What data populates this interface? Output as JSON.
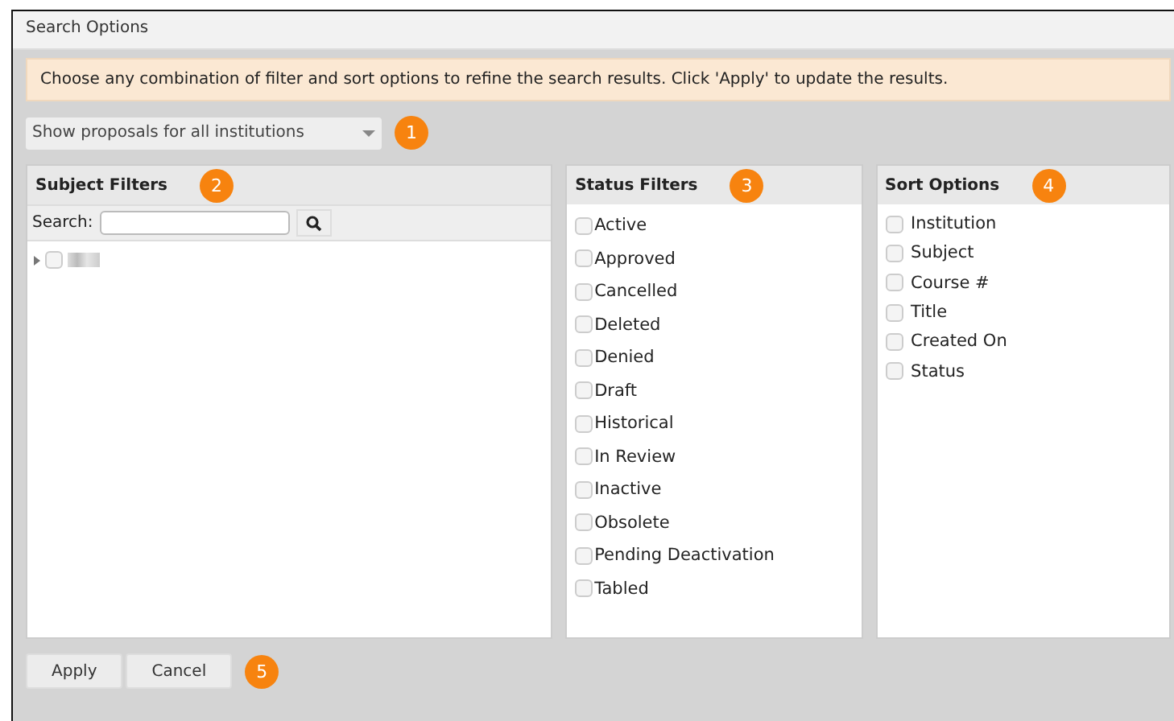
{
  "window": {
    "title": "Search Options"
  },
  "notice": "Choose any combination of filter and sort options to refine the search results. Click 'Apply' to update the results.",
  "scope_dropdown": {
    "value": "Show proposals for all institutions",
    "badge": "1"
  },
  "subject_filters": {
    "title": "Subject Filters",
    "badge": "2",
    "search_label": "Search:",
    "tree": [
      {
        "expanded": false,
        "checked": false
      }
    ]
  },
  "status_filters": {
    "title": "Status Filters",
    "badge": "3",
    "items": [
      {
        "label": "Active",
        "checked": false
      },
      {
        "label": "Approved",
        "checked": false
      },
      {
        "label": "Cancelled",
        "checked": false
      },
      {
        "label": "Deleted",
        "checked": false
      },
      {
        "label": "Denied",
        "checked": false
      },
      {
        "label": "Draft",
        "checked": false
      },
      {
        "label": "Historical",
        "checked": false
      },
      {
        "label": "In Review",
        "checked": false
      },
      {
        "label": "Inactive",
        "checked": false
      },
      {
        "label": "Obsolete",
        "checked": false
      },
      {
        "label": "Pending Deactivation",
        "checked": false
      },
      {
        "label": "Tabled",
        "checked": false
      }
    ]
  },
  "sort_options": {
    "title": "Sort Options",
    "badge": "4",
    "items": [
      {
        "label": "Institution",
        "checked": false
      },
      {
        "label": "Subject",
        "checked": false
      },
      {
        "label": "Course #",
        "checked": false
      },
      {
        "label": "Title",
        "checked": false
      },
      {
        "label": "Created On",
        "checked": false
      },
      {
        "label": "Status",
        "checked": false
      }
    ]
  },
  "buttons": [
    "Apply",
    "Cancel"
  ],
  "buttons_badge": "5"
}
